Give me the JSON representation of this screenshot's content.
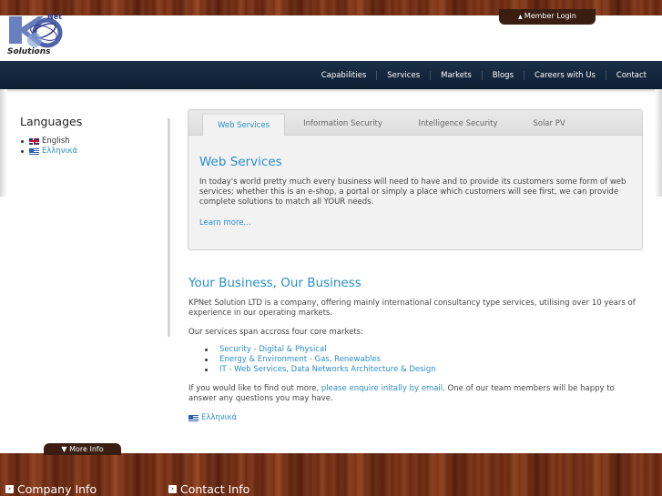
{
  "header": {
    "logo_net": "Net",
    "logo_solutions": "Solutions",
    "member_login": "Member Login"
  },
  "nav": [
    "Capabilities",
    "Services",
    "Markets",
    "Blogs",
    "Careers with Us",
    "Contact"
  ],
  "sidebar": {
    "title": "Languages",
    "languages": [
      {
        "label": "English"
      },
      {
        "label": "Ελληνικά"
      }
    ]
  },
  "tabs": {
    "items": [
      "Web Services",
      "Information Security",
      "Intelligence Security",
      "Solar PV"
    ],
    "active_index": 0,
    "panel": {
      "title": "Web Services",
      "text": " In today's world pretty much every business will need to have and to provide its customers some form of web services; whether this is an e-shop, a portal or simply a place which customers will see first, we can provide complete solutions to match all YOUR needs.",
      "learn_more": "Learn more..."
    }
  },
  "main": {
    "title": "Your Business, Our Business",
    "intro": "KPNet Solution LTD is a company, offering mainly international consultancy type services, utilising over 10 years of experience in our operating markets.",
    "markets_intro": "Our services span accross four core markets:",
    "markets": [
      "Security - Digital & Physical",
      "Energy & Environment  - Gas, Renewables",
      "IT - Web Services, Data Networks Architecture & Design"
    ],
    "enquire_before": "If you would like to find out more, ",
    "enquire_link": "please enquire initally by email",
    "enquire_after": ". One of our team members will be happy to answer any questions you may have.",
    "greek_link": "Ελληνικά"
  },
  "footer": {
    "more_info": "More Info",
    "company_info": "Company Info",
    "contact_info": "Contact Info"
  },
  "colors": {
    "accent": "#2a8ec9",
    "navbar": "#13253b",
    "wood": "#7a3216"
  }
}
